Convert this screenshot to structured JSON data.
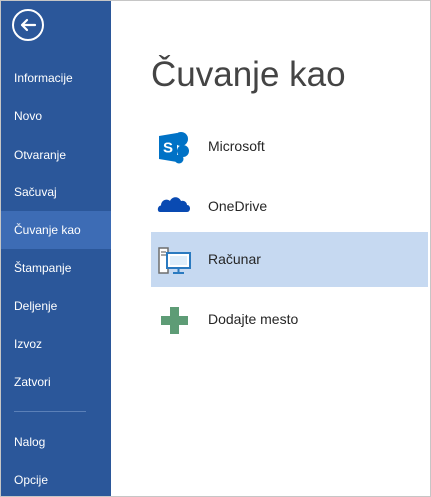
{
  "sidebar": {
    "items": [
      {
        "label": "Informacije"
      },
      {
        "label": "Novo"
      },
      {
        "label": "Otvaranje"
      },
      {
        "label": "Sačuvaj"
      },
      {
        "label": "Čuvanje kao"
      },
      {
        "label": "Štampanje"
      },
      {
        "label": "Deljenje"
      },
      {
        "label": "Izvoz"
      },
      {
        "label": "Zatvori"
      },
      {
        "label": "Nalog"
      },
      {
        "label": "Opcije"
      }
    ],
    "selected": "Čuvanje kao"
  },
  "main": {
    "title": "Čuvanje kao",
    "places": [
      {
        "label": "Microsoft",
        "icon": "sharepoint-icon"
      },
      {
        "label": "OneDrive",
        "icon": "onedrive-cloud-icon"
      },
      {
        "label": "Računar",
        "icon": "computer-icon",
        "selected": true
      },
      {
        "label": "Dodajte mesto",
        "icon": "plus-icon"
      }
    ]
  },
  "colors": {
    "sidebar": "#2b579a",
    "sidebar_selected": "#3d6cb5",
    "place_selected": "#c6d9f1",
    "sharepoint": "#0072c6",
    "onedrive": "#094ab2",
    "plus": "#5e9c76"
  }
}
